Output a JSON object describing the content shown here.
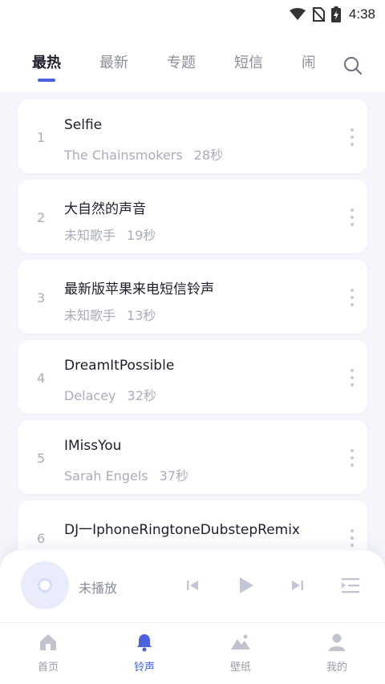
{
  "status_bar": {
    "time": "4:38"
  },
  "tabs": [
    {
      "label": "最热",
      "active": true
    },
    {
      "label": "最新",
      "active": false
    },
    {
      "label": "专题",
      "active": false
    },
    {
      "label": "短信",
      "active": false
    },
    {
      "label": "闹",
      "active": false
    }
  ],
  "songs": [
    {
      "rank": "1",
      "title": "Selfie",
      "artist": "The Chainsmokers",
      "duration": "28秒"
    },
    {
      "rank": "2",
      "title": "大自然的声音",
      "artist": "未知歌手",
      "duration": "19秒"
    },
    {
      "rank": "3",
      "title": "最新版苹果来电短信铃声",
      "artist": "未知歌手",
      "duration": "13秒"
    },
    {
      "rank": "4",
      "title": "DreamItPossible",
      "artist": "Delacey",
      "duration": "32秒"
    },
    {
      "rank": "5",
      "title": "IMissYou",
      "artist": "Sarah Engels",
      "duration": "37秒"
    },
    {
      "rank": "6",
      "title": "DJ一IphoneRingtoneDubstepRemix",
      "artist": "",
      "duration": ""
    }
  ],
  "player": {
    "status": "未播放"
  },
  "nav": [
    {
      "label": "首页",
      "icon": "home-icon",
      "active": false
    },
    {
      "label": "铃声",
      "icon": "bell-icon",
      "active": true
    },
    {
      "label": "壁纸",
      "icon": "wallpaper-icon",
      "active": false
    },
    {
      "label": "我的",
      "icon": "profile-icon",
      "active": false
    }
  ],
  "colors": {
    "accent": "#4a63e0",
    "background": "#f5f6fb",
    "muted": "#a9acba"
  }
}
